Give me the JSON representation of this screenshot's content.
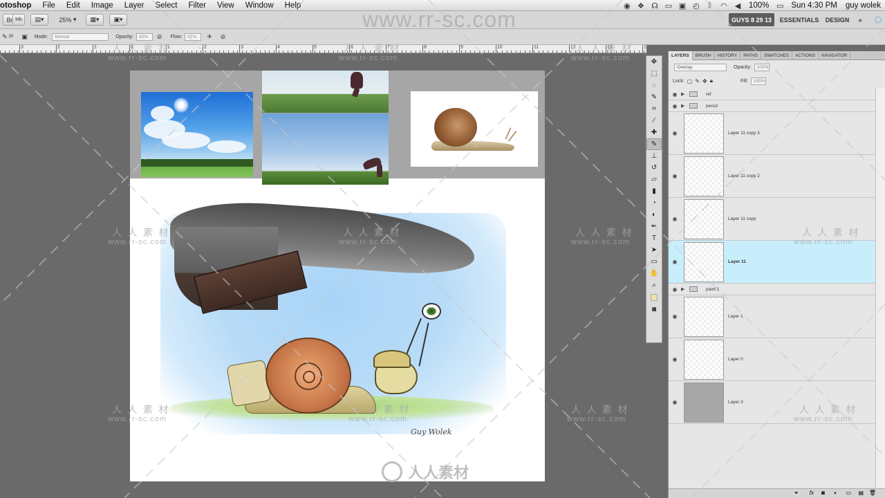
{
  "menubar": {
    "app_name": "otoshop",
    "menus": [
      "File",
      "Edit",
      "Image",
      "Layer",
      "Select",
      "Filter",
      "View",
      "Window",
      "Help"
    ],
    "battery": "100%",
    "clock": "Sun 4:30 PM",
    "user": "guy wolek"
  },
  "options": {
    "zoom": "25%",
    "workspace_badge": "GUYS 8 29 13",
    "essentials": "ESSENTIALS",
    "design": "DESIGN",
    "mode_label": "Mode:",
    "mode_value": "Normal",
    "opacity_label": "Opacity:",
    "opacity_value": "42%",
    "flow_label": "Flow:",
    "flow_value": "47%",
    "brush_size": "30"
  },
  "ruler": {
    "numbers": [
      "3",
      "2",
      "1",
      "0",
      "1",
      "2",
      "3",
      "4",
      "5",
      "6",
      "7",
      "8",
      "9",
      "10",
      "11",
      "12",
      "13",
      "14"
    ]
  },
  "tools": {
    "icons": [
      "move-icon",
      "marquee-icon",
      "lasso-icon",
      "quick-select-icon",
      "crop-icon",
      "eyedropper-icon",
      "healing-icon",
      "brush-icon",
      "stamp-icon",
      "history-brush-icon",
      "eraser-icon",
      "gradient-icon",
      "blur-icon",
      "dodge-icon",
      "pen-icon",
      "type-icon",
      "path-select-icon",
      "shape-icon",
      "hand-icon",
      "zoom-icon"
    ],
    "active": "brush-icon"
  },
  "panel": {
    "tabs": [
      "LAYERS",
      "BRUSH",
      "HISTORY",
      "PATHS",
      "SWATCHES",
      "ACTIONS",
      "NAVIGATOR"
    ],
    "blend_mode": "Overlay",
    "opacity_label": "Opacity:",
    "opacity_value": "100%",
    "lock_label": "Lock:",
    "fill_label": "Fill:",
    "fill_value": "100%",
    "layers": [
      {
        "name": "ref",
        "kind": "group"
      },
      {
        "name": "pencil",
        "kind": "group"
      },
      {
        "name": "Layer 11 copy 3",
        "kind": "layer"
      },
      {
        "name": "Layer 11 copy 2",
        "kind": "layer"
      },
      {
        "name": "Layer 11 copy",
        "kind": "layer"
      },
      {
        "name": "Layer 11",
        "kind": "layer",
        "selected": true
      },
      {
        "name": "paint 1",
        "kind": "group"
      },
      {
        "name": "Layer 1",
        "kind": "layer"
      },
      {
        "name": "Layer 0",
        "kind": "layer"
      },
      {
        "name": "Layer 3",
        "kind": "layer",
        "gray": true
      }
    ]
  },
  "canvas": {
    "signature": "Guy Wolek"
  },
  "watermark": {
    "url": "www.rr-sc.com",
    "cn": "人人素材",
    "cn_spaced": "人 人 素 材",
    "logo_text": "人人素材"
  },
  "colors": {
    "selected_layer": "#c8eefc",
    "workspace_bg": "#6a6a6a"
  }
}
